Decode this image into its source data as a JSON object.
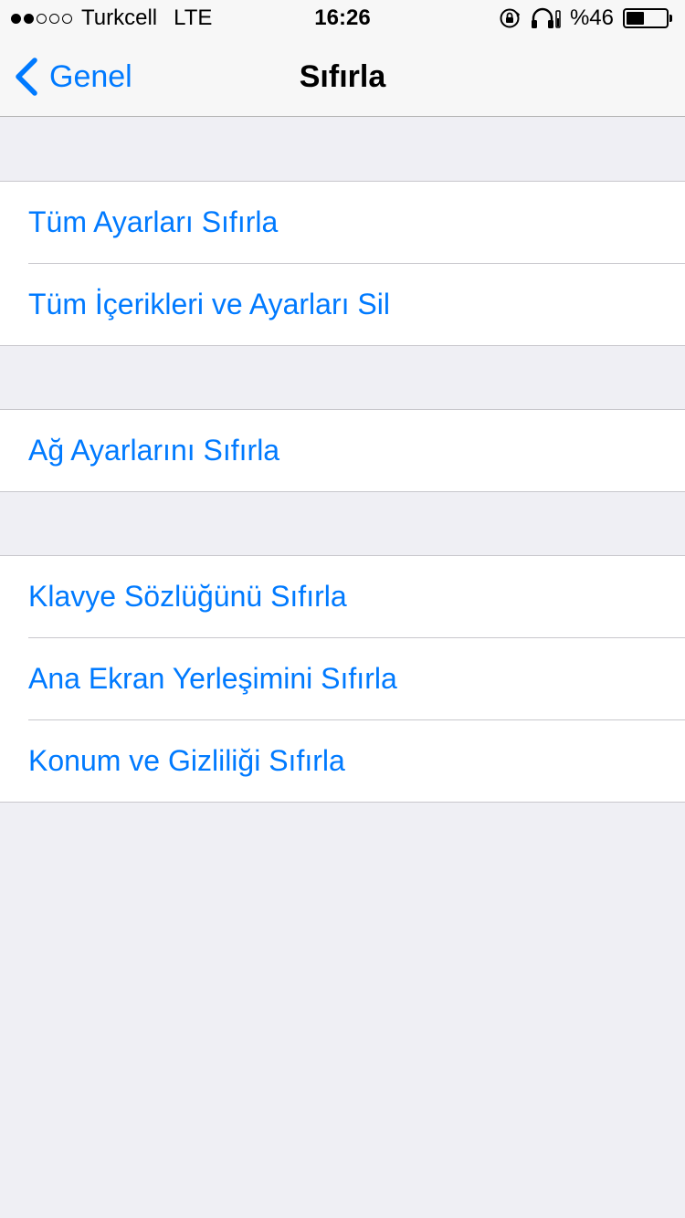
{
  "status_bar": {
    "carrier": "Turkcell",
    "network": "LTE",
    "time": "16:26",
    "battery_text": "%46",
    "battery_level": 0.46,
    "signal_filled": 2,
    "signal_total": 5
  },
  "nav": {
    "back_label": "Genel",
    "title": "Sıfırla"
  },
  "groups": [
    {
      "rows": [
        "Tüm Ayarları Sıfırla",
        "Tüm İçerikleri ve Ayarları Sil"
      ]
    },
    {
      "rows": [
        "Ağ Ayarlarını Sıfırla"
      ]
    },
    {
      "rows": [
        "Klavye Sözlüğünü Sıfırla",
        "Ana Ekran Yerleşimini Sıfırla",
        "Konum ve Gizliliği Sıfırla"
      ]
    }
  ],
  "colors": {
    "accent": "#007aff",
    "background": "#efeff4",
    "separator": "#c8c7cc"
  }
}
